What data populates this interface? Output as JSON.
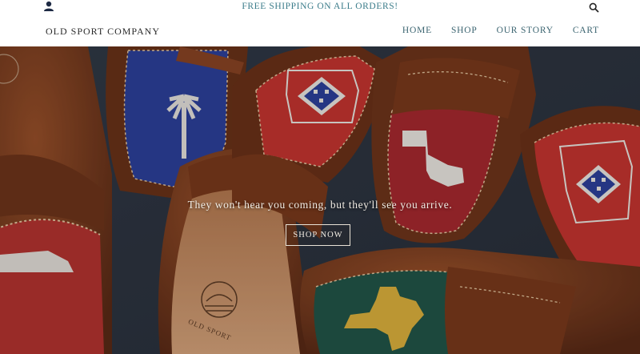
{
  "announcement": "FREE SHIPPING ON ALL ORDERS!",
  "brand": "OLD SPORT COMPANY",
  "nav": [
    {
      "label": "HOME"
    },
    {
      "label": "SHOP"
    },
    {
      "label": "OUR STORY"
    },
    {
      "label": "CART"
    }
  ],
  "icons": {
    "account": "user-icon",
    "search": "search-icon"
  },
  "hero": {
    "tagline": "They won't hear you coming, but they'll see you arrive.",
    "cta_label": "SHOP NOW",
    "logo_text": "OLD SPORT"
  },
  "colors": {
    "announcement": "#3b7c8a",
    "nav_link": "#3b6470",
    "hero_bg": "#2b3340",
    "leather": "#7a3b1c",
    "needlepoint_red": "#c8332c",
    "needlepoint_blue": "#2a3f9c",
    "needlepoint_green": "#1f5546",
    "state_gold": "#e1b43a"
  }
}
